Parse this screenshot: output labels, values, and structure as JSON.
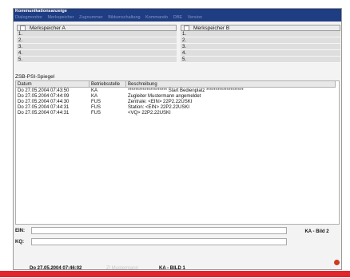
{
  "window": {
    "title": "Kommunikationsanzeige"
  },
  "menu": [
    "Dialogmonitor",
    "Merkspeicher",
    "Zugnummer",
    "Bildumschaltung",
    "Kommando",
    "DBE",
    "Version"
  ],
  "merkspeicher_a": {
    "title": "Merkspeicher A",
    "rows": [
      "1.",
      "2.",
      "3.",
      "4.",
      "5."
    ]
  },
  "merkspeicher_b": {
    "title": "Merkspeicher B",
    "rows": [
      "1.",
      "2.",
      "3.",
      "4.",
      "5."
    ]
  },
  "spiegel": {
    "title": "ZSB-PSI-Spiegel",
    "columns": [
      "Datum",
      "Betriebsstelle",
      "Beschreibung"
    ],
    "rows": [
      {
        "datum": "Do 27.05.2004 07:43:50",
        "betriebsstelle": "KA",
        "beschreibung": "********************* Start Bedienplatz ********************"
      },
      {
        "datum": "Do 27.05.2004 07:44:09",
        "betriebsstelle": "KA",
        "beschreibung": "Zugleiter Mustermann angemeldet"
      },
      {
        "datum": "Do 27.05.2004 07:44:30",
        "betriebsstelle": "FUS",
        "beschreibung": "Zentrale: <EIN>   22P2.22USKI"
      },
      {
        "datum": "Do 27.05.2004 07:44:31",
        "betriebsstelle": "FUS",
        "beschreibung": "Station: <EIN>   22P2.22USKI"
      },
      {
        "datum": "Do 27.05.2004 07:44:31",
        "betriebsstelle": "FUS",
        "beschreibung": "<VQ>   22P2.22USKI"
      }
    ]
  },
  "fields": {
    "ein_label": "EIN:",
    "kq_label": "KQ:",
    "ein_value": "",
    "kq_value": ""
  },
  "bild_button": "KA - Bild 2",
  "statusbar": {
    "datetime": "Do 27.05.2004 07:46:02",
    "user": "Zl Mustermann",
    "bild": "KA - BILD 1"
  },
  "colors": {
    "titlebar": "#1f3d82",
    "accent": "#e2262e"
  }
}
